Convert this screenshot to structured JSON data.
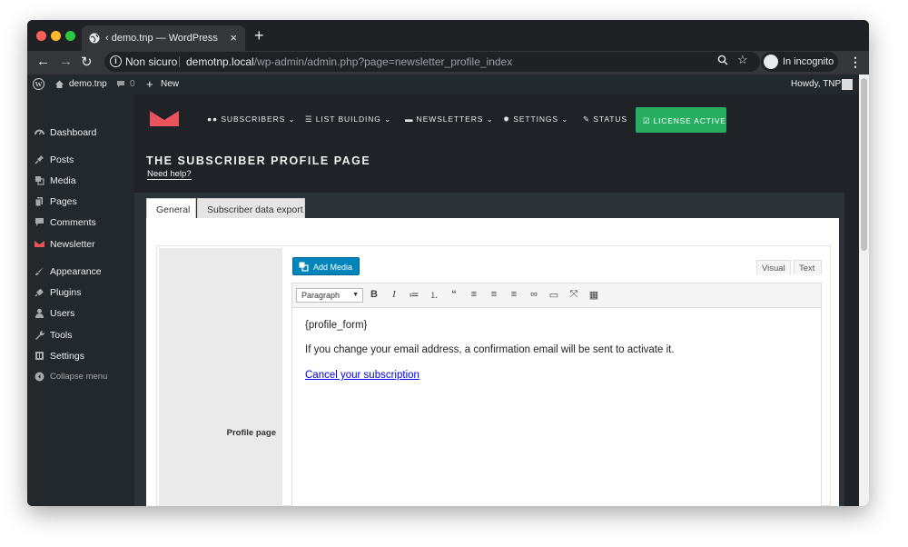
{
  "browser": {
    "tab_title": "‹ demo.tnp — WordPress",
    "close_tab": "×",
    "new_tab": "+",
    "security": "Non sicuro",
    "url_host": "demotnp.local",
    "url_path": "/wp-admin/admin.php?page=newsletter_profile_index",
    "incognito_label": "In incognito",
    "back": "←",
    "forward": "→",
    "reload": "↻",
    "star": "☆",
    "menu": "⋮",
    "traffic_colors": [
      "#ff5f57",
      "#febc2e",
      "#28c840"
    ]
  },
  "adminbar": {
    "site": "demo.tnp",
    "comments_count": "0",
    "new_label": "New",
    "howdy": "Howdy, TNP"
  },
  "sidebar": {
    "items": [
      {
        "label": "Dashboard",
        "icon": "dashboard-icon"
      },
      {
        "label": "Posts",
        "icon": "pin-icon"
      },
      {
        "label": "Media",
        "icon": "media-icon"
      },
      {
        "label": "Pages",
        "icon": "pages-icon"
      },
      {
        "label": "Comments",
        "icon": "comment-icon"
      },
      {
        "label": "Newsletter",
        "icon": "newsletter-logo-icon"
      },
      {
        "label": "Appearance",
        "icon": "brush-icon"
      },
      {
        "label": "Plugins",
        "icon": "plugin-icon"
      },
      {
        "label": "Users",
        "icon": "user-icon"
      },
      {
        "label": "Tools",
        "icon": "wrench-icon"
      },
      {
        "label": "Settings",
        "icon": "settings-icon"
      }
    ],
    "collapse": "Collapse menu"
  },
  "plugin_nav": {
    "subscribers": "SUBSCRIBERS",
    "list_building": "LIST BUILDING",
    "newsletters": "NEWSLETTERS",
    "settings": "SETTINGS",
    "status": "STATUS",
    "license": "LICENSE ACTIVE",
    "brand_color": "#e8535c",
    "license_color": "#27ae60"
  },
  "page": {
    "title": "THE SUBSCRIBER PROFILE PAGE",
    "help": "Need help?",
    "tabs": [
      "General",
      "Subscriber data export"
    ]
  },
  "form": {
    "field_label": "Profile page",
    "add_media": "Add Media",
    "visual": "Visual",
    "text": "Text",
    "format": "Paragraph",
    "content": {
      "line1": "{profile_form}",
      "line2": "If you change your email address, a confirmation email will be sent to activate it.",
      "link": "Cancel your subscription"
    }
  }
}
